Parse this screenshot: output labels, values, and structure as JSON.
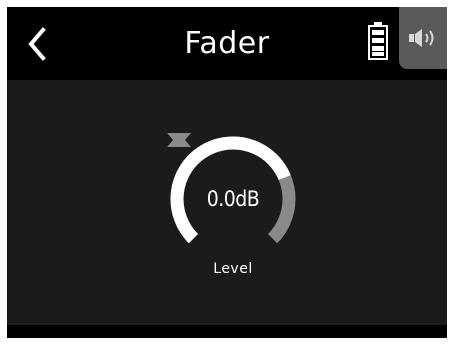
{
  "header": {
    "title": "Fader",
    "back_icon": "chevron-left-icon",
    "battery_icon": "battery-icon",
    "speaker_icon": "speaker-icon"
  },
  "fader": {
    "value_text": "0.0dB",
    "label": "Level",
    "knob_fill_fraction": 0.75
  },
  "colors": {
    "background": "#1b1b1b",
    "header": "#000000",
    "knob_filled": "#ffffff",
    "knob_unfilled": "#8a8a8a",
    "arrow": "#8a8a8a",
    "speaker_button": "#5a5a5a"
  }
}
